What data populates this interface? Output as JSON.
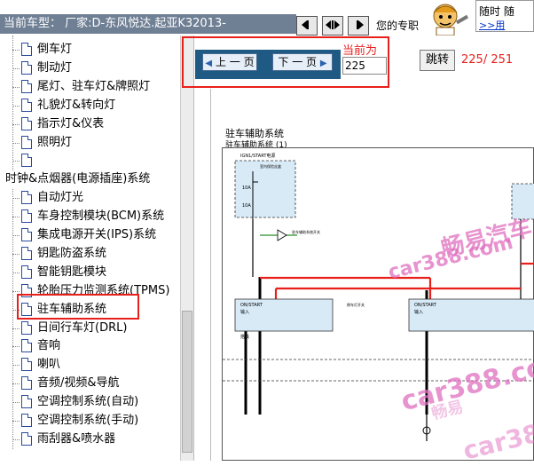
{
  "header": {
    "label": "当前车型：   厂家:D-东风悦达.起亚K32013-",
    "toolbar_icons": [
      "nav-first-icon",
      "nav-split-icon",
      "nav-last-icon"
    ],
    "right_text": "您的专职",
    "ad": {
      "line1": "随时 随",
      "line2": ">>用"
    }
  },
  "sidebar": {
    "items": [
      {
        "label": "倒车灯",
        "indent": 2
      },
      {
        "label": "制动灯",
        "indent": 2
      },
      {
        "label": "尾灯、驻车灯&牌照灯",
        "indent": 2
      },
      {
        "label": "礼貌灯&转向灯",
        "indent": 2
      },
      {
        "label": "指示灯&仪表",
        "indent": 2
      },
      {
        "label": "照明灯",
        "indent": 2
      },
      {
        "label": "",
        "indent": 2
      },
      {
        "label": "时钟&点烟器(电源插座)系统",
        "indent": 0
      },
      {
        "label": "自动灯光",
        "indent": 2
      },
      {
        "label": "车身控制模块(BCM)系统",
        "indent": 2
      },
      {
        "label": "集成电源开关(IPS)系统",
        "indent": 2
      },
      {
        "label": "钥匙防盗系统",
        "indent": 2
      },
      {
        "label": "智能钥匙模块",
        "indent": 2
      },
      {
        "label": "轮胎压力监测系统(TPMS)",
        "indent": 2
      },
      {
        "label": "驻车辅助系统",
        "indent": 2
      },
      {
        "label": "日间行车灯(DRL)",
        "indent": 2
      },
      {
        "label": "音响",
        "indent": 2
      },
      {
        "label": "喇叭",
        "indent": 2
      },
      {
        "label": "音频/视频&导航",
        "indent": 2
      },
      {
        "label": "空调控制系统(自动)",
        "indent": 2
      },
      {
        "label": "空调控制系统(手动)",
        "indent": 2
      },
      {
        "label": "雨刮器&喷水器",
        "indent": 2
      }
    ],
    "selected": "驻车辅助系统"
  },
  "nav": {
    "prev_label": "上 一 页",
    "next_label": "下 一 页",
    "current_label": "当前为",
    "page_value": "225",
    "jump_label": "跳转",
    "page_count": "225/ 251"
  },
  "document": {
    "title": "驻车辅助系统",
    "subtitle": "驻车辅助系统 (1)",
    "diagram_texts": {
      "ign": "IGN1/START电源",
      "fuse_box": "室内保险丝盒",
      "fuse_a": "10A",
      "fuse_b": "10A",
      "module_left_a": "ON/START",
      "module_left_b": "输入",
      "module_left_c": "驻车辅助系统开关",
      "module_right_a": "ON/START",
      "module_right_b": "输入",
      "sensor_note": "倒车灯开关",
      "ground_label": "搭铁"
    }
  },
  "colors": {
    "header_bg": "#6f7f94",
    "nav_blue": "#1f5a85",
    "highlight_red": "#e8201c",
    "watermark": "#e070c0"
  },
  "watermarks": [
    "畅易汽车",
    "car388.com",
    "car388.com",
    "畅易",
    "car388.com"
  ]
}
